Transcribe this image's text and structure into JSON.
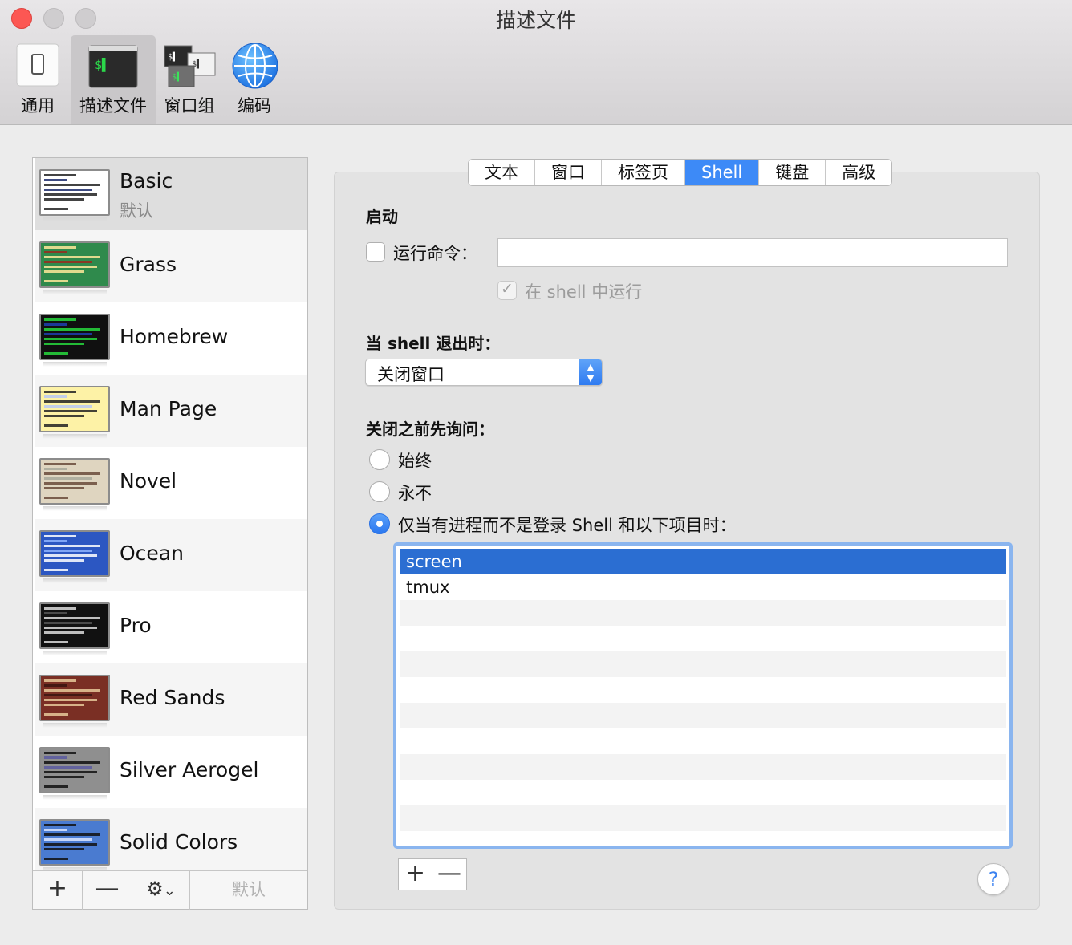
{
  "window": {
    "title": "描述文件"
  },
  "toolbar": {
    "items": [
      {
        "label": "通用"
      },
      {
        "label": "描述文件"
      },
      {
        "label": "窗口组"
      },
      {
        "label": "编码"
      }
    ],
    "icon_texts": {
      "profile_prompt": "$▌",
      "group_prompt_1": "$▌",
      "group_prompt_2": "$▌",
      "group_prompt_3": "$▌"
    }
  },
  "profiles": [
    {
      "name": "Basic",
      "subtitle": "默认",
      "bg": "#ffffff",
      "fg": "#222222",
      "accent": "#1b2a6b"
    },
    {
      "name": "Grass",
      "bg": "#2f8a4c",
      "fg": "#ffe89a",
      "accent": "#9a2a1f"
    },
    {
      "name": "Homebrew",
      "bg": "#101010",
      "fg": "#27d83d",
      "accent": "#1d3fb0"
    },
    {
      "name": "Man Page",
      "bg": "#fdf2a6",
      "fg": "#222222",
      "accent": "#b9c8f5"
    },
    {
      "name": "Novel",
      "bg": "#dfd5c0",
      "fg": "#6a4a3a",
      "accent": "#a8a89a"
    },
    {
      "name": "Ocean",
      "bg": "#2c57c2",
      "fg": "#ffffff",
      "accent": "#8fb4ff"
    },
    {
      "name": "Pro",
      "bg": "#111111",
      "fg": "#dddddd",
      "accent": "#555555"
    },
    {
      "name": "Red Sands",
      "bg": "#7a2f24",
      "fg": "#e8c99a",
      "accent": "#3a1410"
    },
    {
      "name": "Silver Aerogel",
      "bg": "#8f8f8f",
      "fg": "#111111",
      "accent": "#5a5aa0"
    },
    {
      "name": "Solid Colors",
      "bg": "#4a7bd0",
      "fg": "#111111",
      "accent": "#dde6ff"
    }
  ],
  "sidebar_bottom": {
    "add": "+",
    "remove": "—",
    "gear": "⚙",
    "chevron": "⌄",
    "default": "默认"
  },
  "tabs": [
    {
      "label": "文本"
    },
    {
      "label": "窗口"
    },
    {
      "label": "标签页"
    },
    {
      "label": "Shell",
      "active": true
    },
    {
      "label": "键盘"
    },
    {
      "label": "高级"
    }
  ],
  "startup": {
    "title": "启动",
    "run_command_label": "运行命令：",
    "run_command_value": "",
    "run_in_shell_label": "在 shell 中运行"
  },
  "on_exit": {
    "title": "当 shell 退出时：",
    "selected": "关闭窗口"
  },
  "ask_before_close": {
    "title": "关闭之前先询问：",
    "options": [
      {
        "label": "始终",
        "selected": false
      },
      {
        "label": "永不",
        "selected": false
      },
      {
        "label": "仅当有进程而不是登录 Shell 和以下项目时：",
        "selected": true
      }
    ],
    "processes": [
      "screen",
      "tmux"
    ]
  },
  "list_buttons": {
    "add": "+",
    "remove": "—"
  },
  "help": "?",
  "colors": {
    "accent": "#3d8af7",
    "selection": "#2b6ed2",
    "close": "#fc5753"
  }
}
